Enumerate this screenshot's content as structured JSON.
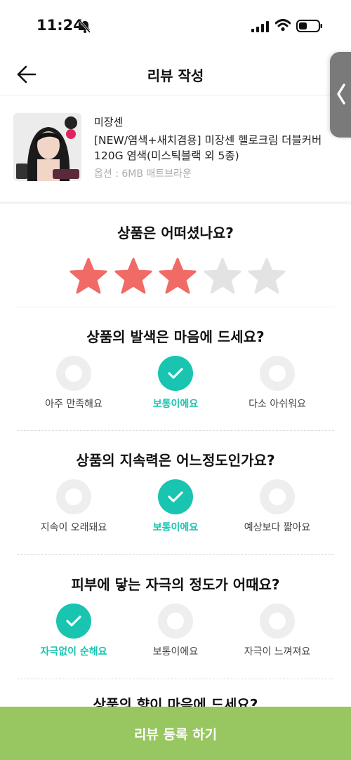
{
  "status_bar": {
    "time": "11:24"
  },
  "header": {
    "title": "리뷰 작성"
  },
  "product": {
    "brand": "미장센",
    "name": "[NEW/염색+새치겸용] 미장센 헬로크림 더블커버 120G 염색(미스틱블랙 외 5종)",
    "option": "옵션 : 6MB 매트브라운"
  },
  "rating": {
    "question": "상품은 어떠셨나요?",
    "value": 3,
    "max": 5,
    "colors": {
      "filled": "#f06a66",
      "empty": "#e3e3e3"
    }
  },
  "questions": [
    {
      "question": "상품의 발색은 마음에 드세요?",
      "options": [
        "아주 만족해요",
        "보통이에요",
        "다소 아쉬워요"
      ],
      "selected": 1
    },
    {
      "question": "상품의 지속력은 어느정도인가요?",
      "options": [
        "지속이 오래돼요",
        "보통이에요",
        "예상보다 짧아요"
      ],
      "selected": 1
    },
    {
      "question": "피부에 닿는 자극의 정도가 어때요?",
      "options": [
        "자극없이 순해요",
        "보통이에요",
        "자극이 느껴져요"
      ],
      "selected": 0
    }
  ],
  "next_question_partial": "상품의 향이 마음에 드세요?",
  "submit": {
    "label": "리뷰 등록 하기"
  },
  "accent_color": "#19c4b0",
  "submit_color": "#98c660"
}
